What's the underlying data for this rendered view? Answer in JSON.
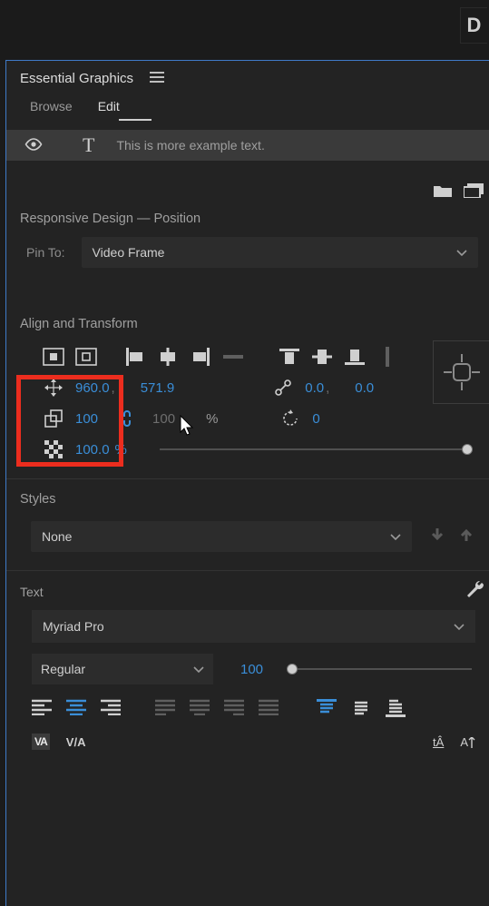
{
  "panel": {
    "title": "Essential Graphics"
  },
  "tabs": {
    "browse": "Browse",
    "edit": "Edit"
  },
  "layer": {
    "name": "This is more example text."
  },
  "responsive": {
    "title": "Responsive Design — Position",
    "pin_label": "Pin To:",
    "pin_value": "Video Frame"
  },
  "align": {
    "title": "Align and Transform",
    "pos_x": "960.0",
    "pos_x_sep": ",",
    "pos_y": "571.9",
    "anchor_x": "0.0",
    "anchor_x_sep": ",",
    "anchor_y": "0.0",
    "scale": "100",
    "scale_linked": "100",
    "rotation": "0",
    "opacity": "100.0",
    "pct1": "%",
    "pct2": "%"
  },
  "styles": {
    "title": "Styles",
    "value": "None"
  },
  "text": {
    "title": "Text",
    "font": "Myriad Pro",
    "weight": "Regular",
    "size": "100"
  }
}
